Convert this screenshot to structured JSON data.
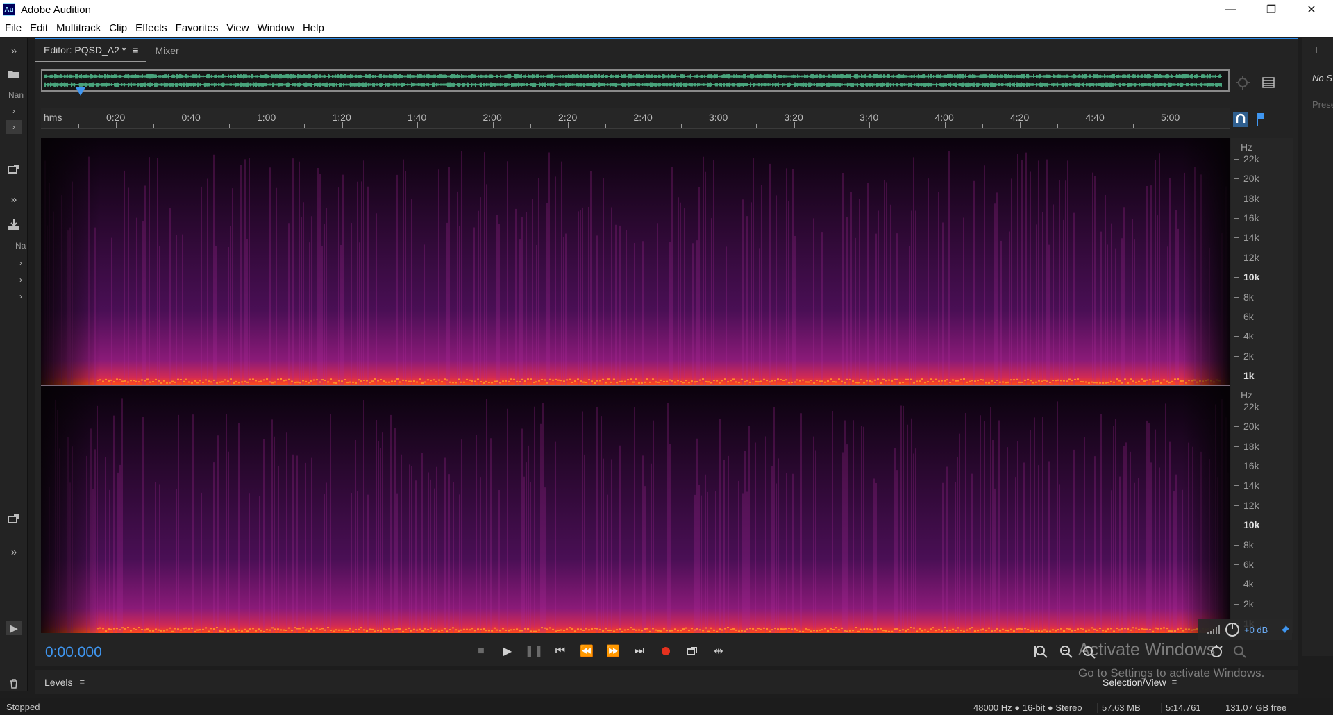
{
  "app": {
    "icon_text": "Au",
    "title": "Adobe Audition"
  },
  "window_controls": {
    "minimize": "—",
    "restore": "❐",
    "close": "✕"
  },
  "menu": [
    "File",
    "Edit",
    "Multitrack",
    "Clip",
    "Effects",
    "Favorites",
    "View",
    "Window",
    "Help"
  ],
  "left_panel": {
    "name_header": "Nan",
    "name_header2": "Na"
  },
  "editor": {
    "tab_editor": "Editor: PQSD_A2 *",
    "tab_menu_icon": "≡",
    "tab_mixer": "Mixer"
  },
  "ruler": {
    "unit": "hms",
    "labels": [
      "0:20",
      "0:40",
      "1:00",
      "1:20",
      "1:40",
      "2:00",
      "2:20",
      "2:40",
      "3:00",
      "3:20",
      "3:40",
      "4:00",
      "4:20",
      "4:40",
      "5:00"
    ]
  },
  "frequency_scale": {
    "unit": "Hz",
    "labels": [
      "22k",
      "20k",
      "18k",
      "16k",
      "14k",
      "12k",
      "10k",
      "8k",
      "6k",
      "4k",
      "2k",
      "1k"
    ],
    "labels_ch2": [
      "22k",
      "20k",
      "18k",
      "16k",
      "14k",
      "12k",
      "10k",
      "8k",
      "6k",
      "4k",
      "2k",
      "1k"
    ]
  },
  "transport": {
    "timecode": "0:00.000",
    "volume": "+0 dB"
  },
  "panels": {
    "levels": "Levels",
    "levels_menu_icon": "≡",
    "selection_view": "Selection/View",
    "selection_menu_icon": "≡",
    "no_selection": "No S",
    "presets": "Prese"
  },
  "watermark": {
    "line1": "Activate Windows",
    "line2": "Go to Settings to activate Windows."
  },
  "status": {
    "state": "Stopped",
    "format": "48000 Hz ● 16-bit ● Stereo",
    "size": "57.63 MB",
    "duration": "5:14.761",
    "free": "131.07 GB free"
  },
  "colors": {
    "accent": "#3f96f0",
    "waveform": "#5fe0a8",
    "spectral_low": "#ff3a1a",
    "spectral_mid": "#a0208c",
    "spectral_bg": "#0a020c"
  }
}
